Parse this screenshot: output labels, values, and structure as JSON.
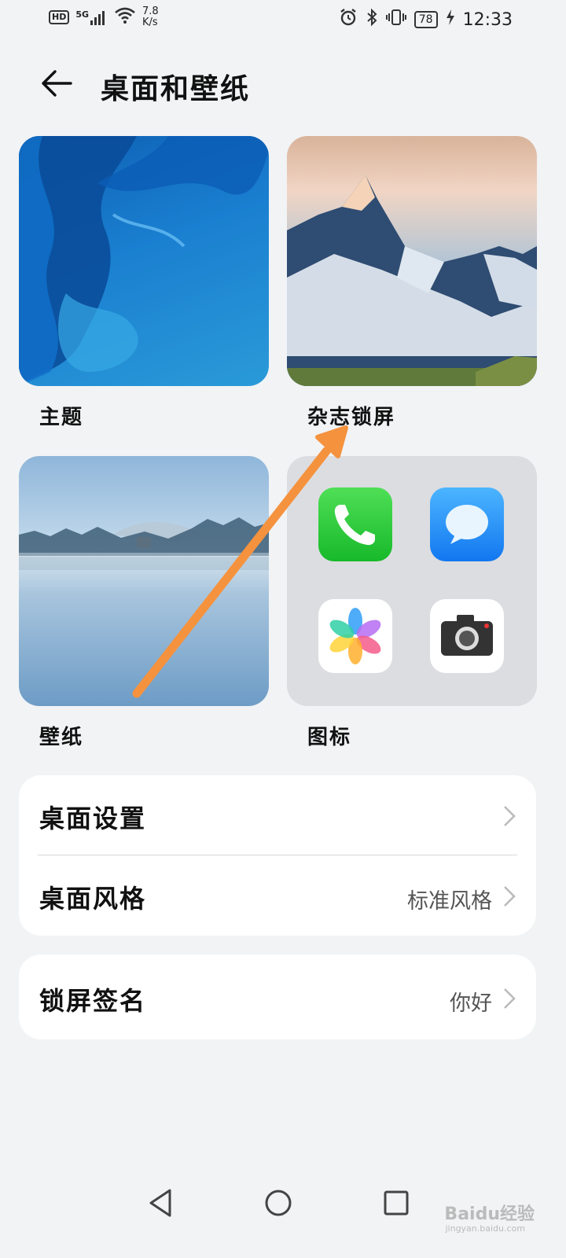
{
  "status_bar": {
    "hd_badge": "HD",
    "signal_label": "5G",
    "network_speed": "7.8",
    "network_speed_unit": "K/s",
    "battery_level": "78",
    "time": "12:33"
  },
  "header": {
    "title": "桌面和壁纸"
  },
  "grid": {
    "theme_label": "主题",
    "magazine_label": "杂志锁屏",
    "wallpaper_label": "壁纸",
    "icons_label": "图标"
  },
  "settings_group_1": {
    "items": [
      {
        "label": "桌面设置",
        "value": ""
      },
      {
        "label": "桌面风格",
        "value": "标准风格"
      }
    ]
  },
  "settings_group_2": {
    "items": [
      {
        "label": "锁屏签名",
        "value": "你好"
      }
    ]
  },
  "watermark": {
    "brand": "Baidu经验",
    "url": "jingyan.baidu.com"
  },
  "colors": {
    "background": "#f1f3f5",
    "annotation_arrow": "#f5923e",
    "phone_icon": "#2ecc40",
    "message_icon": "#1e8ef5"
  }
}
